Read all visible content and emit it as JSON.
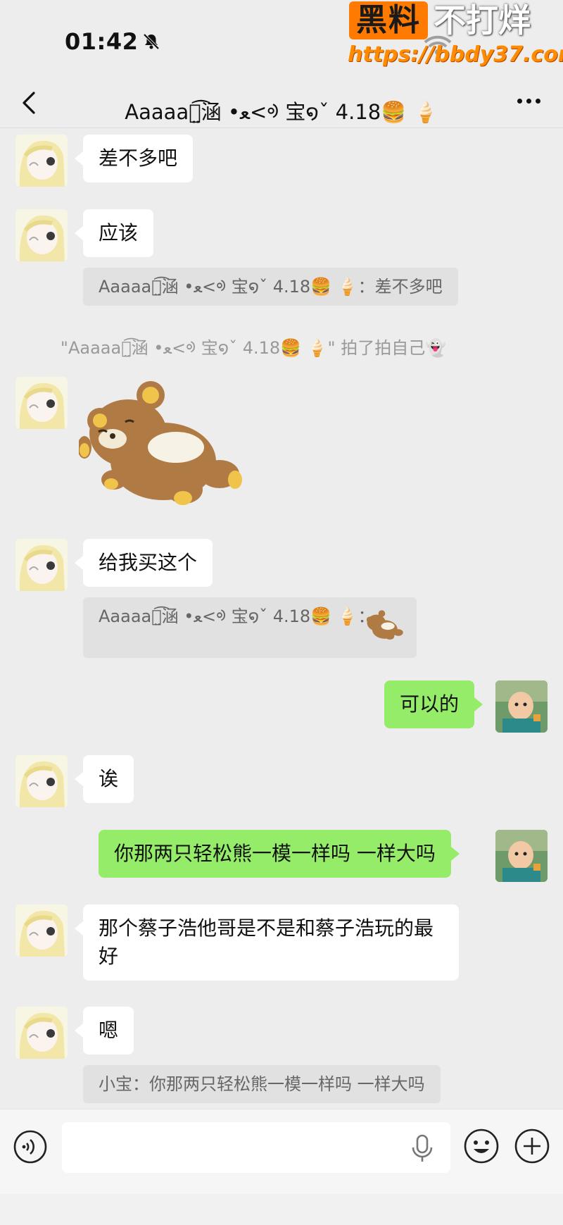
{
  "status": {
    "time": "01:42"
  },
  "watermark": {
    "box": "黑料",
    "text": "不打烊",
    "url": "https://bbdy37.com"
  },
  "header": {
    "title": "Aaaaaศ̤͡涵 •ﻌ<ᢀ 宝໑ˇ 4.18🍔 🍦"
  },
  "messages": {
    "m1": "差不多吧",
    "m2": "应该",
    "q1_name": "Aaaaaศ̤͡涵 •ﻌ<ᢀ 宝໑ˇ 4.18🍔 🍦：",
    "q1_text": "差不多吧",
    "system": "\"Aaaaaศ̤͡涵 •ﻌ<ᢀ 宝໑ˇ 4.18🍔 🍦\" 拍了拍自己👻",
    "m4": "给我买这个",
    "q2_name": "Aaaaaศ̤͡涵 •ﻌ<ᢀ 宝໑ˇ 4.18🍔 🍦：",
    "m5": "可以的",
    "m6": "诶",
    "m7": "你那两只轻松熊一模一样吗 一样大吗",
    "m8": "那个蔡子浩他哥是不是和蔡子浩玩的最好",
    "m9": "嗯",
    "q3": "小宝：你那两只轻松熊一模一样吗 一样大吗"
  },
  "input": {
    "placeholder": ""
  },
  "colors": {
    "incoming": "#ffffff",
    "outgoing": "#95ec69",
    "background": "#ededed",
    "quote": "#e1e1e1"
  }
}
